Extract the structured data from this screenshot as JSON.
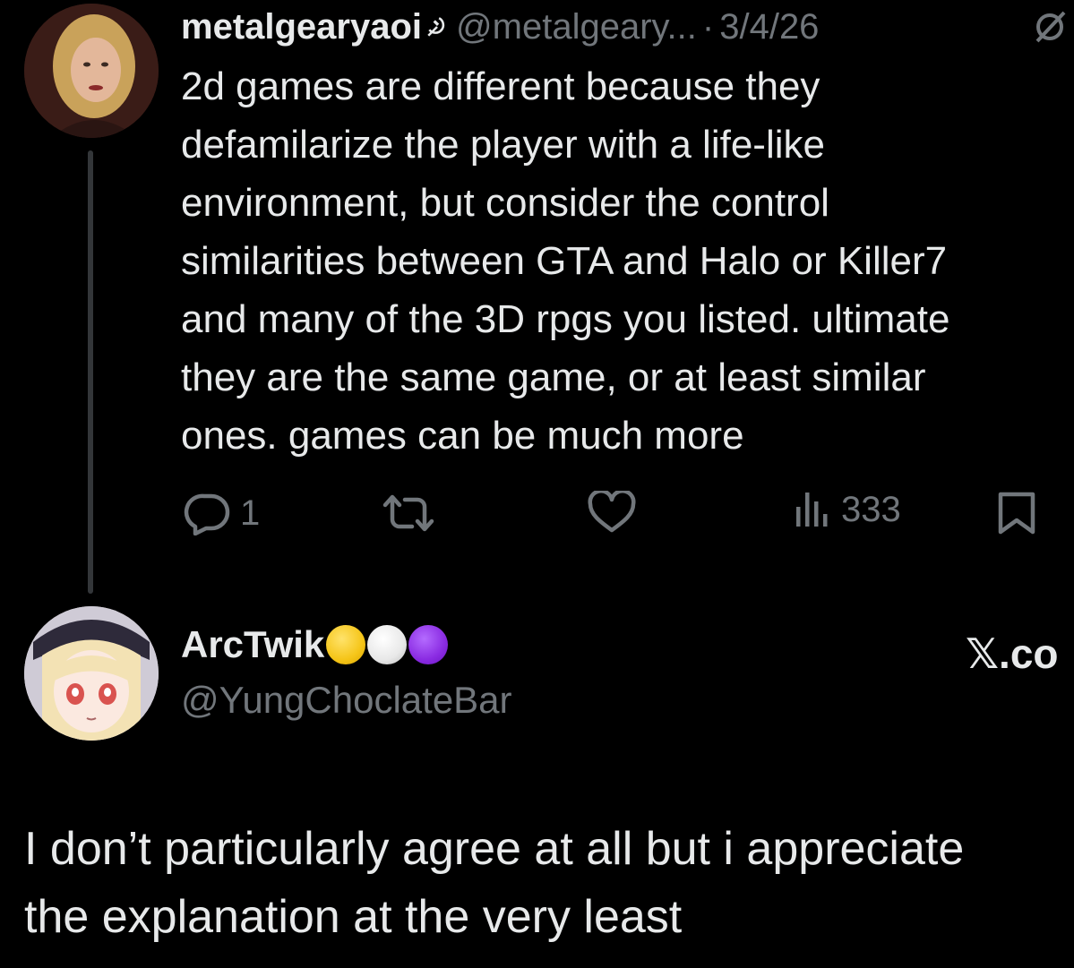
{
  "tweet": {
    "display_name": "metalgearyaoi",
    "name_emoji_icon": "hammer-sickle-icon",
    "handle": "@metalgeary...",
    "separator": "·",
    "date": "3/4/26",
    "body_lines": [
      "2d games are different because they",
      "defamilarize the player with a life-like",
      "environment, but consider the control",
      "similarities between GTA and Halo or Killer7",
      "and many of the 3D rpgs you listed. ultimate",
      "they are the same game, or at least similar",
      "ones. games can be much more"
    ],
    "actions": {
      "reply_icon": "reply-icon",
      "reply_count": "1",
      "retweet_icon": "retweet-icon",
      "like_icon": "heart-icon",
      "views_icon": "views-icon",
      "views_count": "333",
      "bookmark_icon": "bookmark-icon"
    }
  },
  "reply": {
    "display_name": "ArcTwik",
    "name_dots": [
      "#f5c518",
      "#f0f0f0",
      "#8a2be2"
    ],
    "handle": "@YungChoclateBar",
    "watermark": "𝕏.co",
    "body_lines": [
      "I don’t particularly agree at all  but i appreciate",
      "the explanation at the very least"
    ]
  },
  "colors": {
    "background": "#000000",
    "text": "#e7e9ea",
    "muted": "#71767b",
    "thread_line": "#333639"
  }
}
